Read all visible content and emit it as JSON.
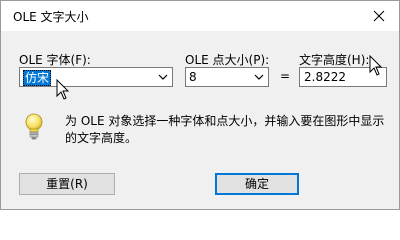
{
  "window": {
    "title": "OLE 文字大小"
  },
  "fields": {
    "font_label": "OLE 字体(F):",
    "font_value": "仿宋",
    "point_label": "OLE 点大小(P):",
    "point_value": "8",
    "equals": "=",
    "height_label": "文字高度(H):",
    "height_value": "2.8222"
  },
  "info": {
    "text": "为 OLE 对象选择一种字体和点大小，并输入要在图形中显示的文字高度。",
    "icon": "lightbulb-icon"
  },
  "buttons": {
    "reset": "重置(R)",
    "ok": "确定"
  },
  "colors": {
    "selection": "#0078d7",
    "dialog_bg": "#f0f0f0"
  }
}
